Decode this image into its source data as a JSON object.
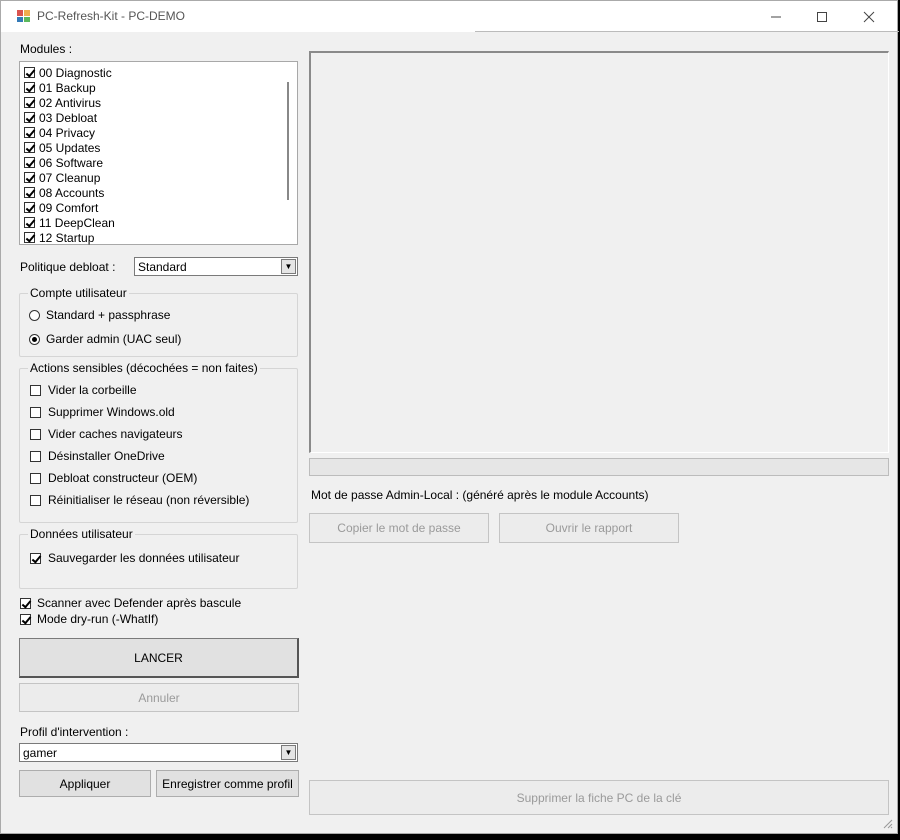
{
  "window": {
    "title": "PC-Refresh-Kit - PC-DEMO",
    "icon": "app-icon",
    "controls": {
      "minimize": "—",
      "maximize": "☐",
      "close": "✕"
    }
  },
  "modules": {
    "label": "Modules :",
    "items": [
      {
        "label": "00 Diagnostic",
        "checked": true
      },
      {
        "label": "01 Backup",
        "checked": true
      },
      {
        "label": "02 Antivirus",
        "checked": true
      },
      {
        "label": "03 Debloat",
        "checked": true
      },
      {
        "label": "04 Privacy",
        "checked": true
      },
      {
        "label": "05 Updates",
        "checked": true
      },
      {
        "label": "06 Software",
        "checked": true
      },
      {
        "label": "07 Cleanup",
        "checked": true
      },
      {
        "label": "08 Accounts",
        "checked": true
      },
      {
        "label": "09 Comfort",
        "checked": true
      },
      {
        "label": "11 DeepClean",
        "checked": true
      },
      {
        "label": "12 Startup",
        "checked": true
      }
    ]
  },
  "debloat_policy": {
    "label": "Politique debloat :",
    "value": "Standard"
  },
  "user_account": {
    "title": "Compte utilisateur",
    "options": [
      {
        "label": "Standard + passphrase",
        "selected": false
      },
      {
        "label": "Garder admin (UAC seul)",
        "selected": true
      }
    ]
  },
  "sensitive_actions": {
    "title": "Actions sensibles (décochées = non faites)",
    "items": [
      {
        "label": "Vider la corbeille",
        "checked": false
      },
      {
        "label": "Supprimer Windows.old",
        "checked": false
      },
      {
        "label": "Vider caches navigateurs",
        "checked": false
      },
      {
        "label": "Désinstaller OneDrive",
        "checked": false
      },
      {
        "label": "Debloat constructeur (OEM)",
        "checked": false
      },
      {
        "label": "Réinitialiser le réseau (non réversible)",
        "checked": false
      }
    ]
  },
  "user_data": {
    "title": "Données utilisateur",
    "items": [
      {
        "label": "Sauvegarder les données utilisateur",
        "checked": true
      }
    ]
  },
  "options": [
    {
      "label": "Scanner avec Defender après bascule",
      "checked": true
    },
    {
      "label": "Mode dry-run (-WhatIf)",
      "checked": true
    }
  ],
  "actions": {
    "run": "LANCER",
    "cancel": "Annuler"
  },
  "profile": {
    "label": "Profil d'intervention :",
    "value": "gamer",
    "apply": "Appliquer",
    "save": "Enregistrer comme profil"
  },
  "right": {
    "log_text": "",
    "progress": 0,
    "password_label": "Mot de passe Admin-Local : (généré après le module Accounts)",
    "copy_password": "Copier le mot de passe",
    "open_report": "Ouvrir le rapport",
    "delete_sheet": "Supprimer la fiche PC de la clé"
  },
  "colors": {
    "progress": "#06b025",
    "window_bg": "#f0f0f0"
  }
}
